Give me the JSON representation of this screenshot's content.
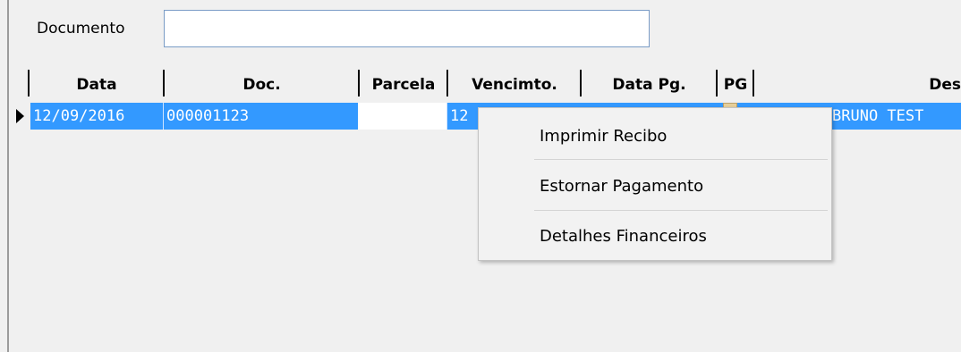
{
  "form": {
    "documento_label": "Documento",
    "documento_value": ""
  },
  "grid": {
    "headers": {
      "data": "Data",
      "doc": "Doc.",
      "parcela": "Parcela",
      "vencimento": "Vencimto.",
      "data_pg": "Data Pg.",
      "pg": "PG",
      "descricao": "Des"
    },
    "rows": [
      {
        "data": "12/09/2016",
        "doc": "000001123",
        "parcela": "",
        "vencimento": "12",
        "data_pg": "",
        "descricao": "BRUNO TEST"
      }
    ]
  },
  "context_menu": {
    "items": [
      "Imprimir Recibo",
      "Estornar Pagamento",
      "Detalhes Financeiros"
    ]
  },
  "colors": {
    "selection": "#3399ff",
    "background": "#f0f0f0"
  }
}
